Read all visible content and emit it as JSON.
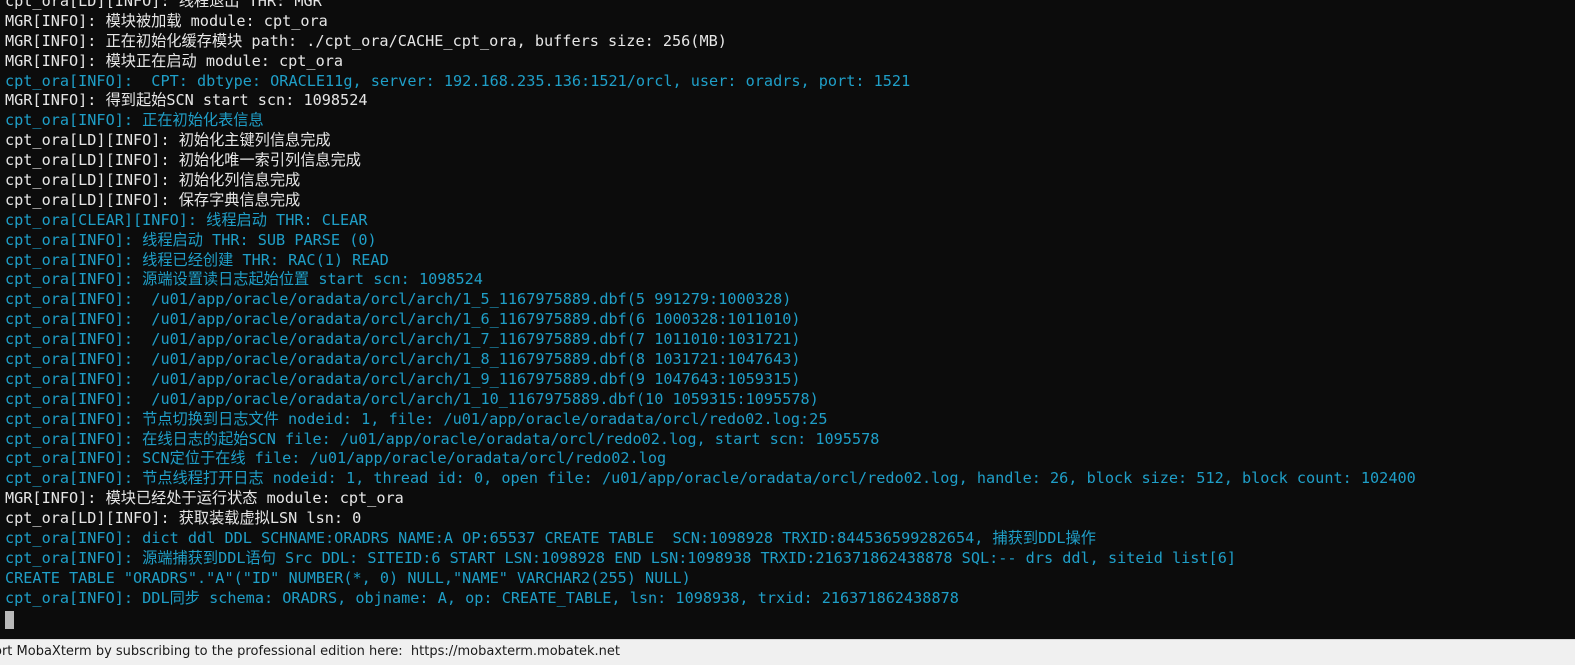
{
  "terminal": {
    "lines": [
      {
        "text": "cpt_ora[LD][INFO]: 线程退出 THR: MGR",
        "color": "white"
      },
      {
        "text": "MGR[INFO]: 模块被加载 module: cpt_ora",
        "color": "white"
      },
      {
        "text": "MGR[INFO]: 正在初始化缓存模块 path: ./cpt_ora/CACHE_cpt_ora, buffers size: 256(MB)",
        "color": "white"
      },
      {
        "text": "MGR[INFO]: 模块正在启动 module: cpt_ora",
        "color": "white"
      },
      {
        "text": "cpt_ora[INFO]:  CPT: dbtype: ORACLE11g, server: 192.168.235.136:1521/orcl, user: oradrs, port: 1521",
        "color": "cyan"
      },
      {
        "text": "MGR[INFO]: 得到起始SCN start scn: 1098524",
        "color": "white"
      },
      {
        "text": "cpt_ora[INFO]: 正在初始化表信息",
        "color": "cyan"
      },
      {
        "text": "cpt_ora[LD][INFO]: 初始化主键列信息完成",
        "color": "white"
      },
      {
        "text": "cpt_ora[LD][INFO]: 初始化唯一索引列信息完成",
        "color": "white"
      },
      {
        "text": "cpt_ora[LD][INFO]: 初始化列信息完成",
        "color": "white"
      },
      {
        "text": "cpt_ora[LD][INFO]: 保存字典信息完成",
        "color": "white"
      },
      {
        "text": "cpt_ora[CLEAR][INFO]: 线程启动 THR: CLEAR",
        "color": "cyan"
      },
      {
        "text": "cpt_ora[INFO]: 线程启动 THR: SUB PARSE (0)",
        "color": "cyan"
      },
      {
        "text": "cpt_ora[INFO]: 线程已经创建 THR: RAC(1) READ",
        "color": "cyan"
      },
      {
        "text": "cpt_ora[INFO]: 源端设置读日志起始位置 start scn: 1098524",
        "color": "cyan"
      },
      {
        "text": "cpt_ora[INFO]:  /u01/app/oracle/oradata/orcl/arch/1_5_1167975889.dbf(5 991279:1000328)",
        "color": "cyan"
      },
      {
        "text": "cpt_ora[INFO]:  /u01/app/oracle/oradata/orcl/arch/1_6_1167975889.dbf(6 1000328:1011010)",
        "color": "cyan"
      },
      {
        "text": "cpt_ora[INFO]:  /u01/app/oracle/oradata/orcl/arch/1_7_1167975889.dbf(7 1011010:1031721)",
        "color": "cyan"
      },
      {
        "text": "cpt_ora[INFO]:  /u01/app/oracle/oradata/orcl/arch/1_8_1167975889.dbf(8 1031721:1047643)",
        "color": "cyan"
      },
      {
        "text": "cpt_ora[INFO]:  /u01/app/oracle/oradata/orcl/arch/1_9_1167975889.dbf(9 1047643:1059315)",
        "color": "cyan"
      },
      {
        "text": "cpt_ora[INFO]:  /u01/app/oracle/oradata/orcl/arch/1_10_1167975889.dbf(10 1059315:1095578)",
        "color": "cyan"
      },
      {
        "text": "cpt_ora[INFO]: 节点切换到日志文件 nodeid: 1, file: /u01/app/oracle/oradata/orcl/redo02.log:25",
        "color": "cyan"
      },
      {
        "text": "cpt_ora[INFO]: 在线日志的起始SCN file: /u01/app/oracle/oradata/orcl/redo02.log, start scn: 1095578",
        "color": "cyan"
      },
      {
        "text": "cpt_ora[INFO]: SCN定位于在线 file: /u01/app/oracle/oradata/orcl/redo02.log",
        "color": "cyan"
      },
      {
        "text": "cpt_ora[INFO]: 节点线程打开日志 nodeid: 1, thread id: 0, open file: /u01/app/oracle/oradata/orcl/redo02.log, handle: 26, block size: 512, block count: 102400",
        "color": "cyan"
      },
      {
        "text": "MGR[INFO]: 模块已经处于运行状态 module: cpt_ora",
        "color": "white"
      },
      {
        "text": "cpt_ora[LD][INFO]: 获取装载虚拟LSN lsn: 0",
        "color": "white"
      },
      {
        "text": "cpt_ora[INFO]: dict ddl DDL SCHNAME:ORADRS NAME:A OP:65537 CREATE TABLE  SCN:1098928 TRXID:844536599282654, 捕获到DDL操作",
        "color": "cyan"
      },
      {
        "text": "cpt_ora[INFO]: 源端捕获到DDL语句 Src DDL: SITEID:6 START LSN:1098928 END LSN:1098938 TRXID:216371862438878 SQL:-- drs ddl, siteid list[6]",
        "color": "cyan"
      },
      {
        "text": "CREATE TABLE \"ORADRS\".\"A\"(\"ID\" NUMBER(*, 0) NULL,\"NAME\" VARCHAR2(255) NULL)",
        "color": "cyan"
      },
      {
        "text": "cpt_ora[INFO]: DDL同步 schema: ORADRS, objname: A, op: CREATE_TABLE, lsn: 1098938, trxid: 216371862438878",
        "color": "cyan"
      }
    ]
  },
  "colors": {
    "background": "#0c0c0c",
    "white_text": "#e6e6e6",
    "cyan_text": "#1f9fc8",
    "statusbar_bg": "#f0f0f0"
  },
  "statusbar": {
    "message": "ort MobaXterm by subscribing to the professional edition here:  ",
    "link": "https://mobaxterm.mobatek.net"
  }
}
